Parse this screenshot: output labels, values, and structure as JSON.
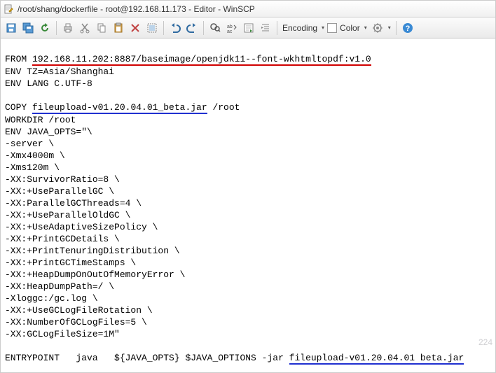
{
  "window": {
    "title": "/root/shang/dockerfile - root@192.168.11.173 - Editor - WinSCP"
  },
  "toolbar": {
    "encoding_label": "Encoding",
    "color_label": "Color"
  },
  "file": {
    "from_prefix": "FROM ",
    "from_value": "192.168.11.202:8887/baseimage/openjdk11--font-wkhtmltopdf:v1.0",
    "env_tz": "ENV TZ=Asia/Shanghai",
    "env_lang": "ENV LANG C.UTF-8",
    "copy_prefix": "COPY ",
    "copy_jar": "fileupload-v01.20.04.01_beta.jar",
    "copy_suffix": " /root",
    "workdir": "WORKDIR /root",
    "java_opts_header": "ENV JAVA_OPTS=\"\\",
    "opt1": "-server \\",
    "opt2": "-Xmx4000m \\",
    "opt3": "-Xms120m \\",
    "opt4": "-XX:SurvivorRatio=8 \\",
    "opt5": "-XX:+UseParallelGC \\",
    "opt6": "-XX:ParallelGCThreads=4 \\",
    "opt7": "-XX:+UseParallelOldGC \\",
    "opt8": "-XX:+UseAdaptiveSizePolicy \\",
    "opt9": "-XX:+PrintGCDetails \\",
    "opt10": "-XX:+PrintTenuringDistribution \\",
    "opt11": "-XX:+PrintGCTimeStamps \\",
    "opt12": "-XX:+HeapDumpOnOutOfMemoryError \\",
    "opt13": "-XX:HeapDumpPath=/ \\",
    "opt14": "-Xloggc:/gc.log \\",
    "opt15": "-XX:+UseGCLogFileRotation \\",
    "opt16": "-XX:NumberOfGCLogFiles=5 \\",
    "opt17": "-XX:GCLogFileSize=1M\"",
    "entry_prefix": "ENTRYPOINT   java   ${JAVA_OPTS} $JAVA_OPTIONS -jar ",
    "entry_jar": "fileupload-v01.20.04.01 beta.jar"
  },
  "watermark": "224"
}
